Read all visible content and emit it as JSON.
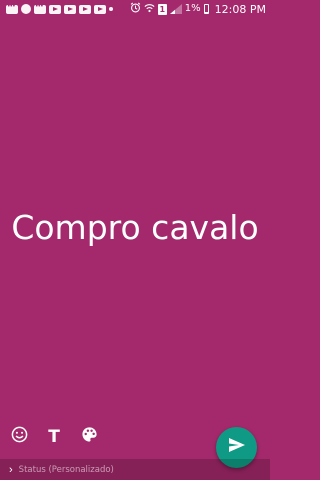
{
  "status_bar": {
    "battery": "1%",
    "time": "12:08 PM",
    "sim_label": "1",
    "notification_icons": [
      "chat-icon",
      "record-icon",
      "chat-icon",
      "youtube-icon",
      "youtube-icon",
      "youtube-icon",
      "youtube-icon",
      "dot-icon"
    ],
    "system_icons": [
      "alarm-icon",
      "wifi-icon",
      "sim-icon",
      "signal-icon",
      "battery-icon"
    ]
  },
  "status_text": "Compro cavalo",
  "background_color": "#a4296c",
  "toolbar": {
    "emoji_icon": "emoji-icon",
    "text_label": "T",
    "palette_icon": "palette-icon"
  },
  "send_button": {
    "icon": "send-icon",
    "color": "#0e9a84"
  },
  "bottom_bar": {
    "chevron": "›",
    "caption": "Status (Personalizado)"
  }
}
